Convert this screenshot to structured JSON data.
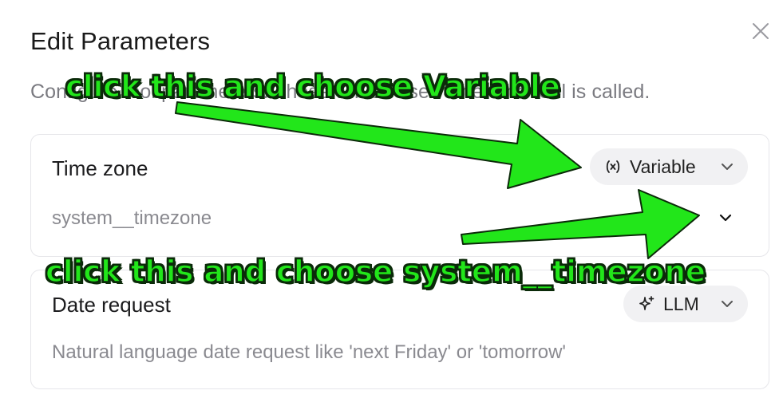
{
  "dialog": {
    "title": "Edit Parameters",
    "description": "Configure tool parameters. These will be used when the tool is called."
  },
  "parameters": [
    {
      "name": "Time zone",
      "mode_label": "Variable",
      "mode_icon": "variable-icon",
      "value": "system__timezone"
    },
    {
      "name": "Date request",
      "mode_label": "LLM",
      "mode_icon": "sparkle-icon",
      "placeholder": "Natural language date request like 'next Friday' or 'tomorrow'"
    }
  ],
  "annotations": {
    "first": "click this and choose Variable",
    "second": "click this and choose system__timezone",
    "color": "#22e61a"
  }
}
